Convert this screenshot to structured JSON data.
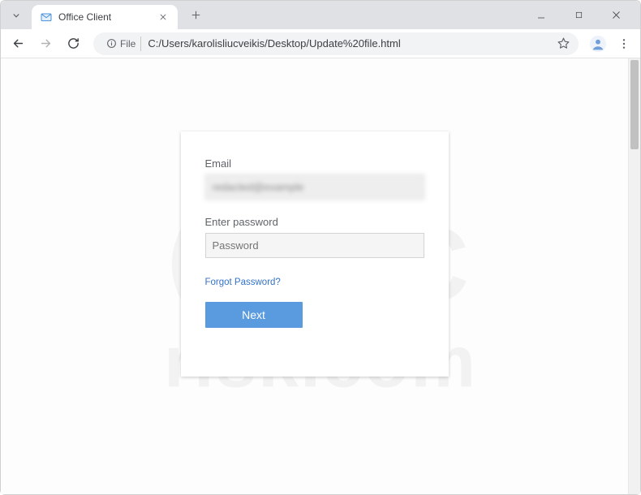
{
  "window": {
    "tab_title": "Office Client"
  },
  "omnibox": {
    "file_chip_label": "File",
    "url": "C:/Users/karolisliucveikis/Desktop/Update%20file.html"
  },
  "form": {
    "email_label": "Email",
    "email_value": "redacted@example",
    "password_label": "Enter password",
    "password_placeholder": "Password",
    "forgot_link": "Forgot Password?",
    "next_button": "Next"
  },
  "watermark": {
    "brand_top": "PC",
    "brand_bottom": "risk.com"
  }
}
